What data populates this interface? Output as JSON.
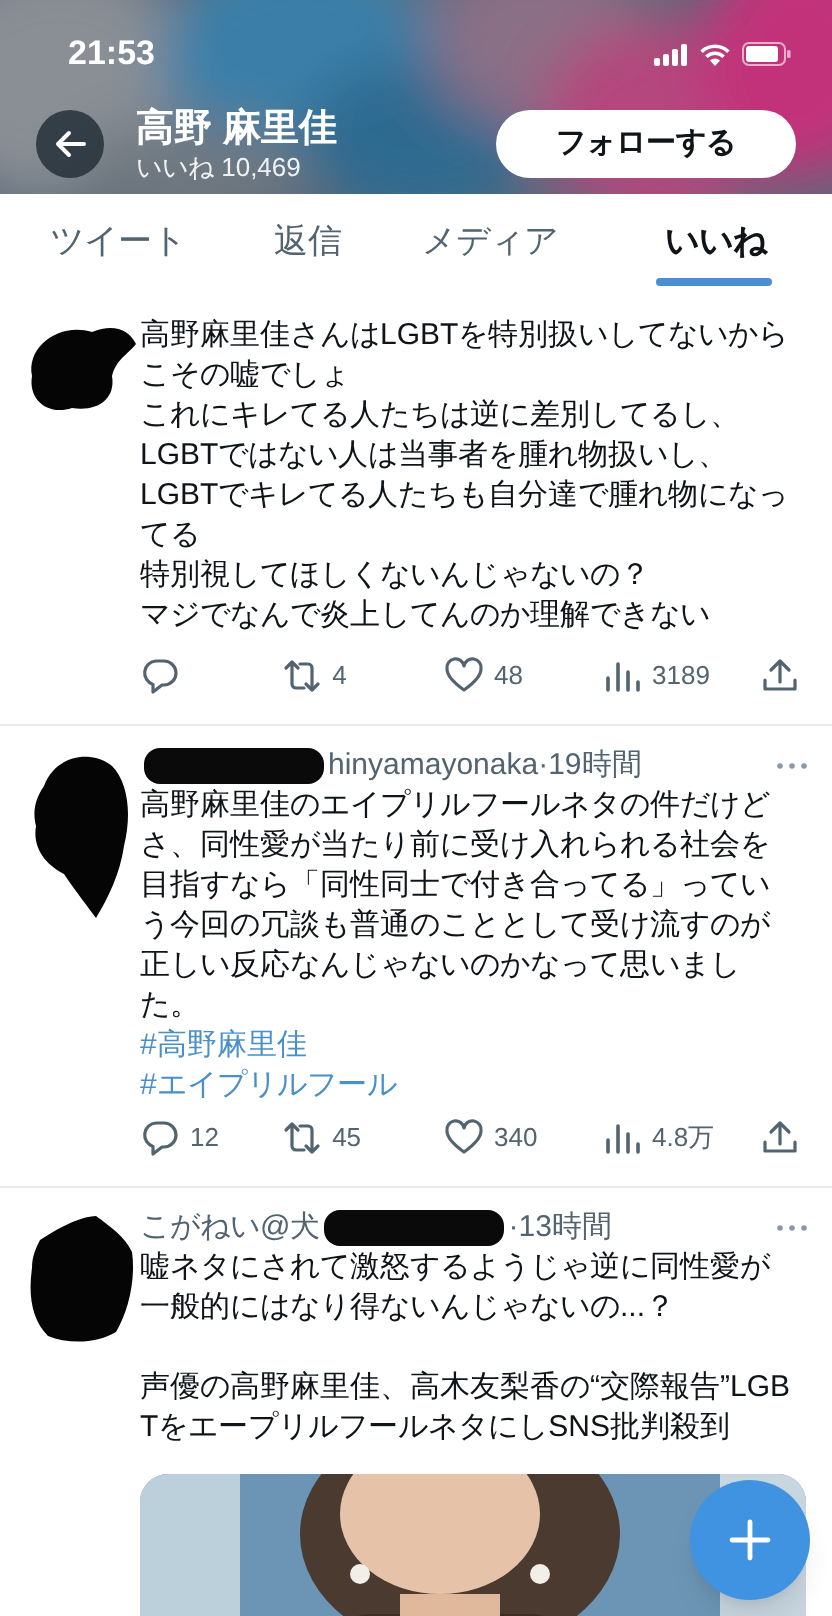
{
  "status_bar": {
    "time": "21:53"
  },
  "profile_header": {
    "name": "高野 麻里佳",
    "likes_count": "いいね 10,469",
    "follow_button": "フォローする"
  },
  "tabs": [
    {
      "label": "ツイート",
      "selected": false
    },
    {
      "label": "返信",
      "selected": false
    },
    {
      "label": "メディア",
      "selected": false
    },
    {
      "label": "いいね",
      "selected": true
    }
  ],
  "tweets": [
    {
      "paragraphs": [
        "高野麻里佳さんはLGBTを特別扱いしてないからこその嘘でしょ",
        "これにキレてる人たちは逆に差別してるし、",
        "LGBTではない人は当事者を腫れ物扱いし、",
        "LGBTでキレてる人たちも自分達で腫れ物になってる",
        "特別視してほしくないんじゃないの？",
        "マジでなんで炎上してんのか理解できない"
      ],
      "actions": [
        {
          "kind": "reply"
        },
        {
          "kind": "retweet",
          "count": "4"
        },
        {
          "kind": "like",
          "count": "48"
        },
        {
          "kind": "views",
          "count": "3189"
        },
        {
          "kind": "share"
        }
      ]
    },
    {
      "header": [
        {
          "kind": "redacted"
        },
        {
          "kind": "handle",
          "text": "hinyamayonaka"
        },
        {
          "kind": "time",
          "text": "·19時間"
        }
      ],
      "more_menu": true,
      "paragraphs": [
        "高野麻里佳のエイプリルフールネタの件だけどさ、同性愛が当たり前に受け入れられる社会を目指すなら「同性同士で付き合ってる」っていう今回の冗談も普通のこととして受け流すのが正しい反応なんじゃないのかなって思いました。"
      ],
      "hashtags": [
        "#高野麻里佳",
        "#エイプリルフール"
      ],
      "actions": [
        {
          "kind": "reply",
          "count": "12"
        },
        {
          "kind": "retweet",
          "count": "45"
        },
        {
          "kind": "like",
          "count": "340"
        },
        {
          "kind": "views",
          "count": "4.8万"
        },
        {
          "kind": "share"
        }
      ]
    },
    {
      "header": [
        {
          "kind": "handle",
          "text": "こがねい@犬"
        },
        {
          "kind": "redacted"
        },
        {
          "kind": "time",
          "text": "·13時間"
        }
      ],
      "more_menu": true,
      "paragraphs": [
        "嘘ネタにされて激怒するようじゃ逆に同性愛が一般的にはなり得ないんじゃないの...？",
        "声優の高野麻里佳、高木友梨香の“交際報告”LGBTをエープリルフールネタにしSNS批判殺到"
      ],
      "media": {
        "kind": "picture"
      }
    }
  ]
}
